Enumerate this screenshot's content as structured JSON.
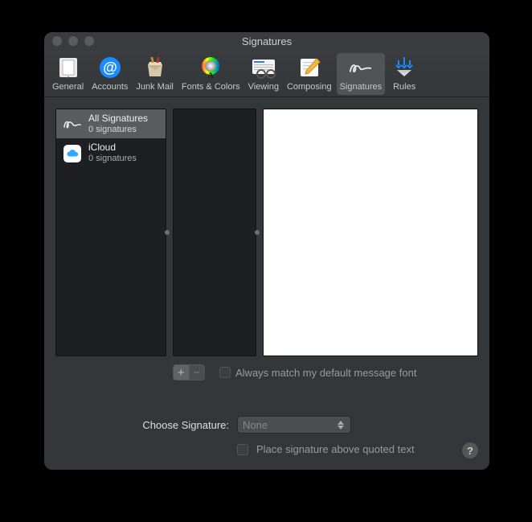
{
  "window": {
    "title": "Signatures"
  },
  "toolbar": {
    "items": [
      {
        "label": "General"
      },
      {
        "label": "Accounts"
      },
      {
        "label": "Junk Mail"
      },
      {
        "label": "Fonts & Colors"
      },
      {
        "label": "Viewing"
      },
      {
        "label": "Composing"
      },
      {
        "label": "Signatures"
      },
      {
        "label": "Rules"
      }
    ]
  },
  "accounts": [
    {
      "title": "All Signatures",
      "subtitle": "0 signatures",
      "selected": true
    },
    {
      "title": "iCloud",
      "subtitle": "0 signatures",
      "selected": false
    }
  ],
  "buttons": {
    "plus": "+",
    "minus": "−"
  },
  "options": {
    "match_font_label": "Always match my default message font",
    "choose_label": "Choose Signature:",
    "choose_value": "None",
    "place_above_label": "Place signature above quoted text"
  },
  "help": "?"
}
